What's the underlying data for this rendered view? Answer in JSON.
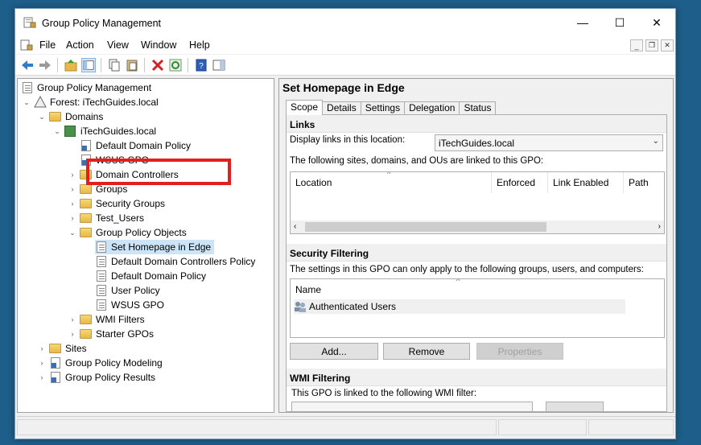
{
  "window": {
    "title": "Group Policy Management",
    "controls": {
      "minimize": "—",
      "maximize": "☐",
      "close": "✕"
    },
    "mdi_controls": {
      "minimize": "_",
      "restore": "❐",
      "close": "✕"
    }
  },
  "menu": {
    "file": "File",
    "action": "Action",
    "view": "View",
    "window": "Window",
    "help": "Help"
  },
  "tree": {
    "root": "Group Policy Management",
    "forest": "Forest: iTechGuides.local",
    "domains": "Domains",
    "domain": "iTechGuides.local",
    "default_domain_policy_link": "Default Domain Policy",
    "wsus_gpo_link": "WSUS GPO",
    "domain_controllers": "Domain Controllers",
    "groups": "Groups",
    "security_groups": "Security Groups",
    "test_users": "Test_Users",
    "group_policy_objects": "Group Policy Objects",
    "set_homepage_in_edge": "Set Homepage in Edge",
    "default_domain_controllers_policy": "Default Domain Controllers Policy",
    "default_domain_policy": "Default Domain Policy",
    "user_policy": "User Policy",
    "wsus_gpo": "WSUS GPO",
    "wmi_filters": "WMI Filters",
    "starter_gpos": "Starter GPOs",
    "sites": "Sites",
    "group_policy_modeling": "Group Policy Modeling",
    "group_policy_results": "Group Policy Results"
  },
  "detail": {
    "title": "Set Homepage in Edge",
    "tabs": [
      "Scope",
      "Details",
      "Settings",
      "Delegation",
      "Status"
    ],
    "links": {
      "heading": "Links",
      "display_label": "Display links in this location:",
      "location_value": "iTechGuides.local",
      "description": "The following sites, domains, and OUs are linked to this GPO:",
      "columns": [
        "Location",
        "Enforced",
        "Link Enabled",
        "Path"
      ]
    },
    "security_filtering": {
      "heading": "Security Filtering",
      "description": "The settings in this GPO can only apply to the following groups, users, and computers:",
      "column": "Name",
      "rows": [
        "Authenticated Users"
      ],
      "buttons": {
        "add": "Add...",
        "remove": "Remove",
        "properties": "Properties"
      }
    },
    "wmi_filtering": {
      "heading": "WMI Filtering",
      "description": "This GPO is linked to the following WMI filter:"
    }
  },
  "colors": {
    "highlight": "#e21f1f",
    "selection": "#cce4f7"
  }
}
